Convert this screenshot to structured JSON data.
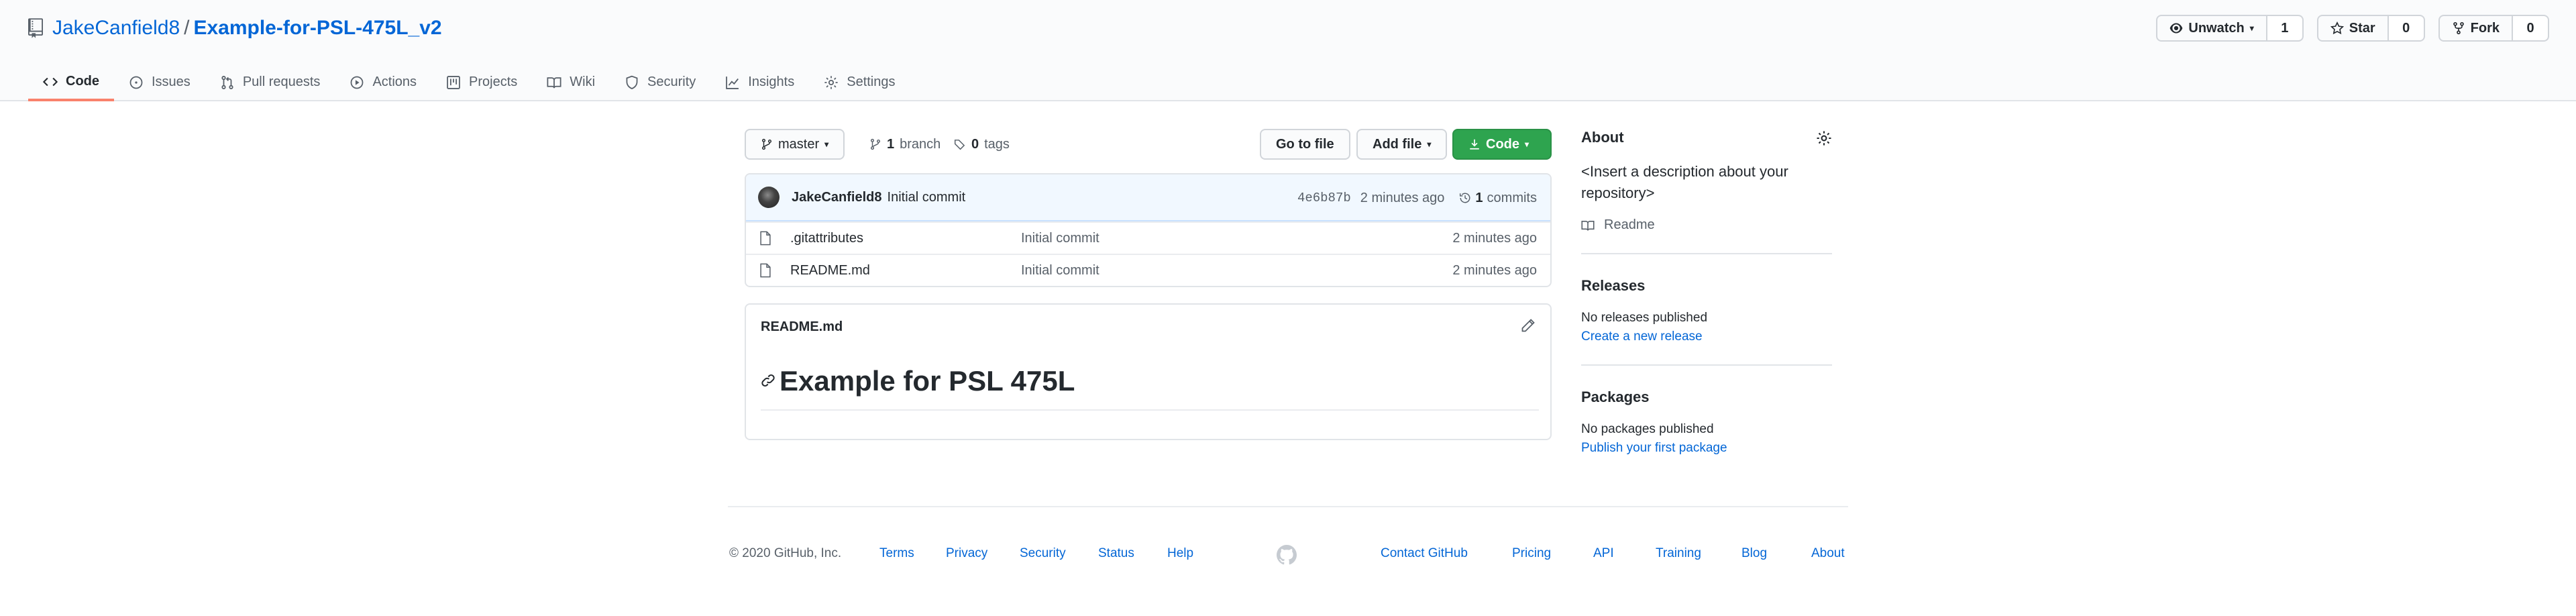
{
  "header": {
    "owner": "JakeCanfield8",
    "separator": "/",
    "repo_name": "Example-for-PSL-475L_v2",
    "unwatch_label": "Unwatch",
    "watch_count": "1",
    "star_label": "Star",
    "star_count": "0",
    "fork_label": "Fork",
    "fork_count": "0"
  },
  "tabs": [
    {
      "label": "Code",
      "icon": "code-icon"
    },
    {
      "label": "Issues",
      "icon": "issue-icon"
    },
    {
      "label": "Pull requests",
      "icon": "pull-request-icon"
    },
    {
      "label": "Actions",
      "icon": "play-icon"
    },
    {
      "label": "Projects",
      "icon": "project-icon"
    },
    {
      "label": "Wiki",
      "icon": "book-icon"
    },
    {
      "label": "Security",
      "icon": "shield-icon"
    },
    {
      "label": "Insights",
      "icon": "graph-icon"
    },
    {
      "label": "Settings",
      "icon": "gear-icon"
    }
  ],
  "branch_bar": {
    "branch_name": "master",
    "branch_count": "1",
    "branch_word": "branch",
    "tag_count": "0",
    "tag_word": "tags",
    "go_to_file": "Go to file",
    "add_file": "Add file",
    "code": "Code"
  },
  "commit": {
    "author": "JakeCanfield8",
    "message": "Initial commit",
    "sha": "4e6b87b",
    "age": "2 minutes ago",
    "count": "1",
    "count_word": "commits"
  },
  "files": [
    {
      "name": ".gitattributes",
      "message": "Initial commit",
      "age": "2 minutes ago"
    },
    {
      "name": "README.md",
      "message": "Initial commit",
      "age": "2 minutes ago"
    }
  ],
  "readme": {
    "title": "README.md",
    "heading": "Example for PSL 475L"
  },
  "sidebar": {
    "about_heading": "About",
    "description": "<Insert a description about your repository>",
    "readme_label": "Readme",
    "releases_heading": "Releases",
    "releases_text": "No releases published",
    "releases_link": "Create a new release",
    "packages_heading": "Packages",
    "packages_text": "No packages published",
    "packages_link": "Publish your first package"
  },
  "footer": {
    "copyright": "© 2020 GitHub, Inc.",
    "left_links": [
      "Terms",
      "Privacy",
      "Security",
      "Status",
      "Help"
    ],
    "right_links": [
      "Contact GitHub",
      "Pricing",
      "API",
      "Training",
      "Blog",
      "About"
    ]
  },
  "colors": {
    "link": "#0366d6",
    "green_button": "#2ea44f",
    "tab_underline": "#f9826c",
    "commit_bar": "#f1f8ff"
  }
}
